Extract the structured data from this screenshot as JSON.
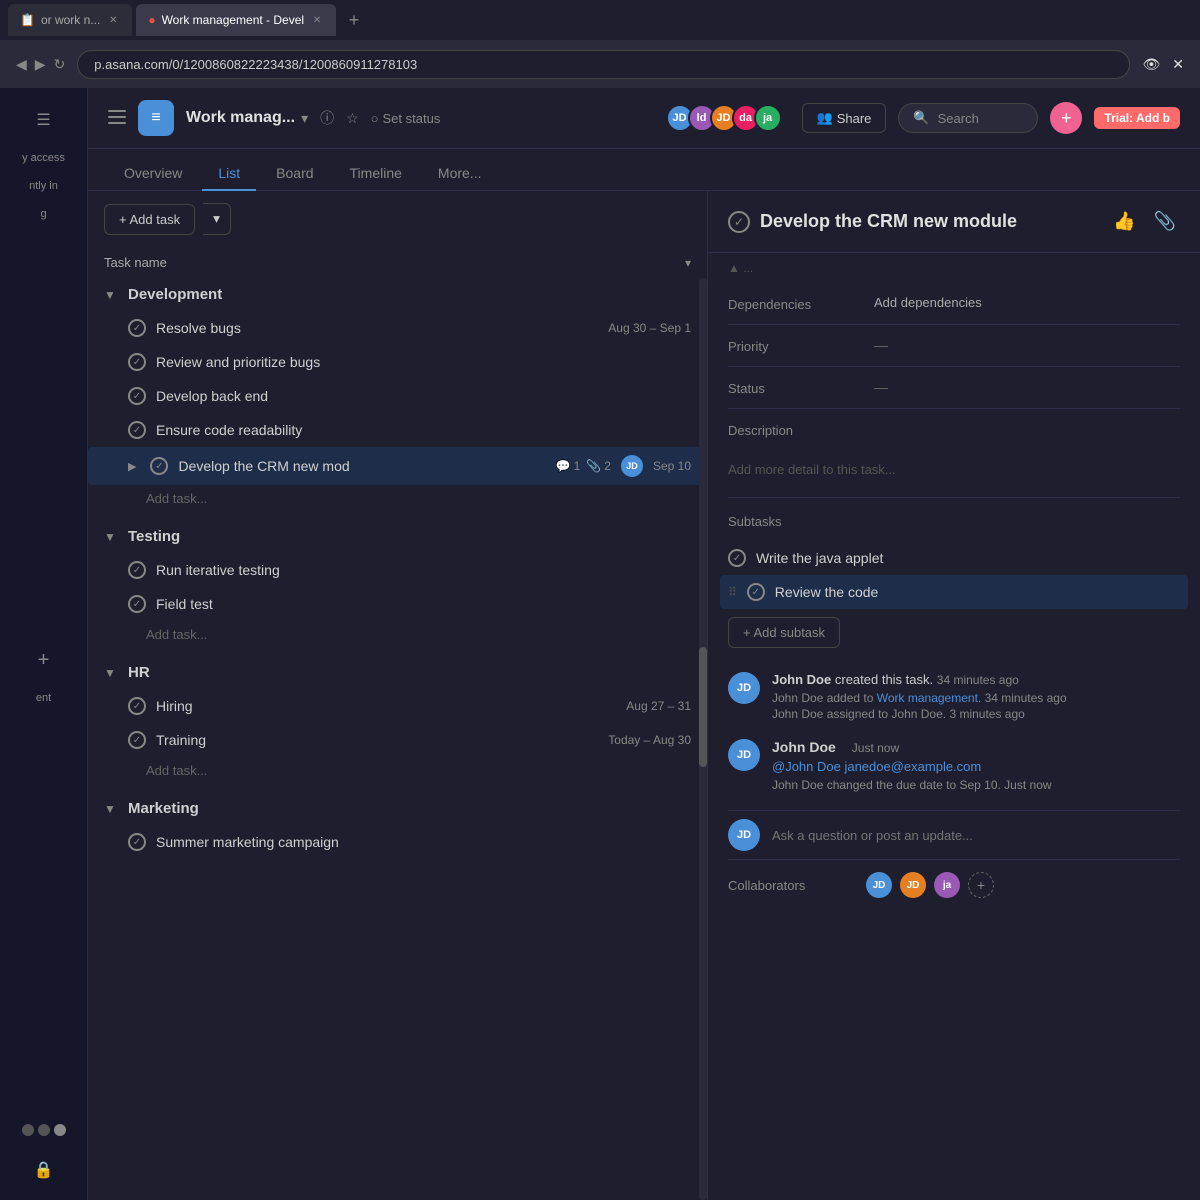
{
  "browser": {
    "tabs": [
      {
        "label": "or work n...",
        "active": false,
        "favicon": "📋"
      },
      {
        "label": "Work management - Devel",
        "active": true,
        "favicon": "🔴"
      }
    ],
    "add_tab": "+",
    "address": "p.asana.com/0/1200860822223438/1200860911278103",
    "nav_icons": [
      "🔒",
      "⭐"
    ]
  },
  "sidebar": {
    "collapse_btn": "☰",
    "plus_btn": "+",
    "access_label": "y access",
    "in_label": "ntly in",
    "g_label": "g",
    "dots": [
      false,
      false,
      true
    ],
    "ent_label": "ent",
    "lock_icon": "🔒"
  },
  "header": {
    "hamburger": "☰",
    "project_icon": "≡",
    "project_title": "Work manag...",
    "expand_icon": "▾",
    "info_icon": "ⓘ",
    "star_icon": "☆",
    "set_status_icon": "○",
    "set_status_label": "Set status",
    "avatars": [
      {
        "initials": "JD",
        "color": "#4a90d9"
      },
      {
        "initials": "ld",
        "color": "#9b59b6"
      },
      {
        "initials": "JD",
        "color": "#e67e22"
      },
      {
        "initials": "da",
        "color": "#e91e63"
      },
      {
        "initials": "ja",
        "color": "#27ae60"
      }
    ],
    "share_icon": "👥",
    "share_label": "Share",
    "search_icon": "🔍",
    "search_label": "Search",
    "add_icon": "+",
    "trial_label": "Trial:",
    "add_b_label": "Add b"
  },
  "nav": {
    "tabs": [
      {
        "label": "Overview",
        "active": false
      },
      {
        "label": "List",
        "active": true
      },
      {
        "label": "Board",
        "active": false
      },
      {
        "label": "Timeline",
        "active": false
      },
      {
        "label": "More...",
        "active": false
      }
    ]
  },
  "toolbar": {
    "add_task_label": "+ Add task",
    "task_name_placeholder": "Task name",
    "filter_arrow": "▾"
  },
  "sections": [
    {
      "name": "Development",
      "tasks": [
        {
          "name": "Resolve bugs",
          "date": "Aug 30 – Sep 1",
          "check": "✓"
        },
        {
          "name": "Review and prioritize bugs",
          "date": "",
          "check": "✓"
        },
        {
          "name": "Develop back end",
          "date": "",
          "check": "✓"
        },
        {
          "name": "Ensure code readability",
          "date": "",
          "check": "✓"
        },
        {
          "name": "Develop the CRM new mod",
          "date": "Sep 10",
          "check": "✓",
          "selected": true,
          "comments": "1",
          "attachments": "2",
          "avatar": "JD"
        }
      ],
      "add_task": "Add task..."
    },
    {
      "name": "Testing",
      "tasks": [
        {
          "name": "Run iterative testing",
          "date": "",
          "check": "✓"
        },
        {
          "name": "Field test",
          "date": "",
          "check": "✓"
        }
      ],
      "add_task": "Add task..."
    },
    {
      "name": "HR",
      "tasks": [
        {
          "name": "Hiring",
          "date": "Aug 27 – 31",
          "check": "✓"
        },
        {
          "name": "Training",
          "date": "Today – Aug 30",
          "check": "✓"
        }
      ],
      "add_task": "Add task..."
    },
    {
      "name": "Marketing",
      "tasks": [
        {
          "name": "Summer marketing campaign",
          "date": "",
          "check": "✓"
        }
      ],
      "add_task": "Add task..."
    }
  ],
  "detail": {
    "title": "Develop the CRM new module",
    "fields": {
      "dependencies_label": "Dependencies",
      "dependencies_action": "Add dependencies",
      "priority_label": "Priority",
      "priority_value": "—",
      "status_label": "Status",
      "status_value": "—",
      "description_label": "Description",
      "description_placeholder": "Add more detail to this task..."
    },
    "subtasks": {
      "label": "Subtasks",
      "items": [
        {
          "name": "Write the java applet",
          "check": "✓"
        },
        {
          "name": "Review the code",
          "check": "✓",
          "highlighted": true
        }
      ],
      "add_label": "+ Add subtask"
    },
    "activity": [
      {
        "avatar": "JD",
        "avatar_color": "#4a90d9",
        "author": "John Doe",
        "action": "created this task.",
        "time": "34 minutes ago",
        "subs": [
          "John Doe added to Work management.  34 minutes ago",
          "John Doe assigned to John Doe.  3 minutes ago"
        ]
      },
      {
        "avatar": "JD",
        "avatar_color": "#4a90d9",
        "author": "John Doe",
        "time": "Just now",
        "mention": "@John Doe janedoe@example.com",
        "sub": "John Doe changed the due date to Sep 10.  Just now"
      }
    ],
    "comment_placeholder": "Ask a question or post an update...",
    "collaborators_label": "Collaborators",
    "collaborators": [
      {
        "initials": "JD",
        "color": "#4a90d9"
      },
      {
        "initials": "JD",
        "color": "#e67e22"
      },
      {
        "initials": "ja",
        "color": "#9b59b6"
      }
    ],
    "add_collaborator": "+"
  }
}
